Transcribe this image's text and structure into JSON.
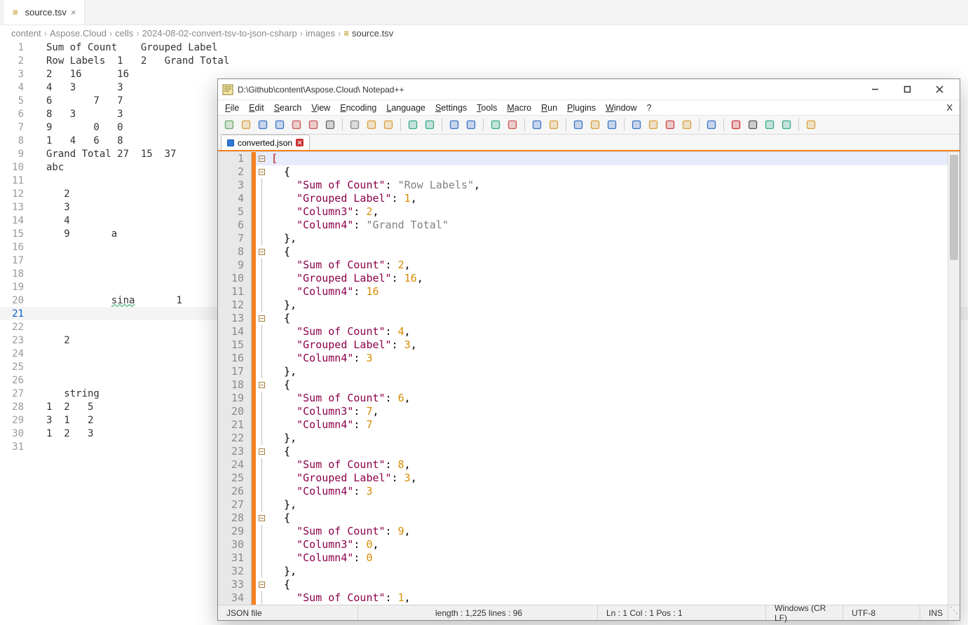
{
  "vs": {
    "tab_label": "source.tsv",
    "breadcrumbs": [
      "content",
      "Aspose.Cloud",
      "cells",
      "2024-08-02-convert-tsv-to-json-csharp",
      "images",
      "source.tsv"
    ],
    "lines": [
      {
        "n": 1,
        "t": "Sum of Count    Grouped Label"
      },
      {
        "n": 2,
        "t": "Row Labels  1   2   Grand Total"
      },
      {
        "n": 3,
        "t": "2   16      16"
      },
      {
        "n": 4,
        "t": "4   3       3"
      },
      {
        "n": 5,
        "t": "6       7   7"
      },
      {
        "n": 6,
        "t": "8   3       3"
      },
      {
        "n": 7,
        "t": "9       0   0"
      },
      {
        "n": 8,
        "t": "1   4   6   8"
      },
      {
        "n": 9,
        "t": "Grand Total 27  15  37"
      },
      {
        "n": 10,
        "t": "abc"
      },
      {
        "n": 11,
        "t": ""
      },
      {
        "n": 12,
        "t": "   2"
      },
      {
        "n": 13,
        "t": "   3"
      },
      {
        "n": 14,
        "t": "   4"
      },
      {
        "n": 15,
        "t": "   9       a"
      },
      {
        "n": 16,
        "t": ""
      },
      {
        "n": 17,
        "t": ""
      },
      {
        "n": 18,
        "t": ""
      },
      {
        "n": 19,
        "t": ""
      },
      {
        "n": 20,
        "t": "           sina       1",
        "wavy": true,
        "wavy_word": "sina"
      },
      {
        "n": 21,
        "t": "",
        "active": true
      },
      {
        "n": 22,
        "t": ""
      },
      {
        "n": 23,
        "t": "   2"
      },
      {
        "n": 24,
        "t": ""
      },
      {
        "n": 25,
        "t": ""
      },
      {
        "n": 26,
        "t": ""
      },
      {
        "n": 27,
        "t": "   string"
      },
      {
        "n": 28,
        "t": "1  2   5"
      },
      {
        "n": 29,
        "t": "3  1   2"
      },
      {
        "n": 30,
        "t": "1  2   3"
      },
      {
        "n": 31,
        "t": ""
      }
    ]
  },
  "npp": {
    "title": "D:\\Github\\content\\Aspose.Cloud\\ Notepad++",
    "menus": [
      "File",
      "Edit",
      "Search",
      "View",
      "Encoding",
      "Language",
      "Settings",
      "Tools",
      "Macro",
      "Run",
      "Plugins",
      "Window",
      "?"
    ],
    "tab_label": "converted.json",
    "status": {
      "type": "JSON file",
      "length": "length : 1,225    lines : 96",
      "pos": "Ln : 1    Col : 1    Pos : 1",
      "eol": "Windows (CR LF)",
      "enc": "UTF-8",
      "mode": "INS"
    },
    "code_lines": [
      {
        "n": 1,
        "fold": "box",
        "hl": true,
        "spans": [
          [
            "brk",
            "["
          ]
        ]
      },
      {
        "n": 2,
        "fold": "box",
        "spans": [
          [
            "punc",
            "  {"
          ]
        ]
      },
      {
        "n": 3,
        "fold": "pipe",
        "spans": [
          [
            "punc",
            "    "
          ],
          [
            "key",
            "\"Sum of Count\""
          ],
          [
            "punc",
            ": "
          ],
          [
            "str",
            "\"Row Labels\""
          ],
          [
            "punc",
            ","
          ]
        ]
      },
      {
        "n": 4,
        "fold": "pipe",
        "spans": [
          [
            "punc",
            "    "
          ],
          [
            "key",
            "\"Grouped Label\""
          ],
          [
            "punc",
            ": "
          ],
          [
            "num",
            "1"
          ],
          [
            "punc",
            ","
          ]
        ]
      },
      {
        "n": 5,
        "fold": "pipe",
        "spans": [
          [
            "punc",
            "    "
          ],
          [
            "key",
            "\"Column3\""
          ],
          [
            "punc",
            ": "
          ],
          [
            "num",
            "2"
          ],
          [
            "punc",
            ","
          ]
        ]
      },
      {
        "n": 6,
        "fold": "pipe",
        "spans": [
          [
            "punc",
            "    "
          ],
          [
            "key",
            "\"Column4\""
          ],
          [
            "punc",
            ": "
          ],
          [
            "str",
            "\"Grand Total\""
          ]
        ]
      },
      {
        "n": 7,
        "fold": "pipe",
        "spans": [
          [
            "punc",
            "  },"
          ]
        ]
      },
      {
        "n": 8,
        "fold": "box",
        "spans": [
          [
            "punc",
            "  {"
          ]
        ]
      },
      {
        "n": 9,
        "fold": "pipe",
        "spans": [
          [
            "punc",
            "    "
          ],
          [
            "key",
            "\"Sum of Count\""
          ],
          [
            "punc",
            ": "
          ],
          [
            "num",
            "2"
          ],
          [
            "punc",
            ","
          ]
        ]
      },
      {
        "n": 10,
        "fold": "pipe",
        "spans": [
          [
            "punc",
            "    "
          ],
          [
            "key",
            "\"Grouped Label\""
          ],
          [
            "punc",
            ": "
          ],
          [
            "num",
            "16"
          ],
          [
            "punc",
            ","
          ]
        ]
      },
      {
        "n": 11,
        "fold": "pipe",
        "spans": [
          [
            "punc",
            "    "
          ],
          [
            "key",
            "\"Column4\""
          ],
          [
            "punc",
            ": "
          ],
          [
            "num",
            "16"
          ]
        ]
      },
      {
        "n": 12,
        "fold": "pipe",
        "spans": [
          [
            "punc",
            "  },"
          ]
        ]
      },
      {
        "n": 13,
        "fold": "box",
        "spans": [
          [
            "punc",
            "  {"
          ]
        ]
      },
      {
        "n": 14,
        "fold": "pipe",
        "spans": [
          [
            "punc",
            "    "
          ],
          [
            "key",
            "\"Sum of Count\""
          ],
          [
            "punc",
            ": "
          ],
          [
            "num",
            "4"
          ],
          [
            "punc",
            ","
          ]
        ]
      },
      {
        "n": 15,
        "fold": "pipe",
        "spans": [
          [
            "punc",
            "    "
          ],
          [
            "key",
            "\"Grouped Label\""
          ],
          [
            "punc",
            ": "
          ],
          [
            "num",
            "3"
          ],
          [
            "punc",
            ","
          ]
        ]
      },
      {
        "n": 16,
        "fold": "pipe",
        "spans": [
          [
            "punc",
            "    "
          ],
          [
            "key",
            "\"Column4\""
          ],
          [
            "punc",
            ": "
          ],
          [
            "num",
            "3"
          ]
        ]
      },
      {
        "n": 17,
        "fold": "pipe",
        "spans": [
          [
            "punc",
            "  },"
          ]
        ]
      },
      {
        "n": 18,
        "fold": "box",
        "spans": [
          [
            "punc",
            "  {"
          ]
        ]
      },
      {
        "n": 19,
        "fold": "pipe",
        "spans": [
          [
            "punc",
            "    "
          ],
          [
            "key",
            "\"Sum of Count\""
          ],
          [
            "punc",
            ": "
          ],
          [
            "num",
            "6"
          ],
          [
            "punc",
            ","
          ]
        ]
      },
      {
        "n": 20,
        "fold": "pipe",
        "spans": [
          [
            "punc",
            "    "
          ],
          [
            "key",
            "\"Column3\""
          ],
          [
            "punc",
            ": "
          ],
          [
            "num",
            "7"
          ],
          [
            "punc",
            ","
          ]
        ]
      },
      {
        "n": 21,
        "fold": "pipe",
        "spans": [
          [
            "punc",
            "    "
          ],
          [
            "key",
            "\"Column4\""
          ],
          [
            "punc",
            ": "
          ],
          [
            "num",
            "7"
          ]
        ]
      },
      {
        "n": 22,
        "fold": "pipe",
        "spans": [
          [
            "punc",
            "  },"
          ]
        ]
      },
      {
        "n": 23,
        "fold": "box",
        "spans": [
          [
            "punc",
            "  {"
          ]
        ]
      },
      {
        "n": 24,
        "fold": "pipe",
        "spans": [
          [
            "punc",
            "    "
          ],
          [
            "key",
            "\"Sum of Count\""
          ],
          [
            "punc",
            ": "
          ],
          [
            "num",
            "8"
          ],
          [
            "punc",
            ","
          ]
        ]
      },
      {
        "n": 25,
        "fold": "pipe",
        "spans": [
          [
            "punc",
            "    "
          ],
          [
            "key",
            "\"Grouped Label\""
          ],
          [
            "punc",
            ": "
          ],
          [
            "num",
            "3"
          ],
          [
            "punc",
            ","
          ]
        ]
      },
      {
        "n": 26,
        "fold": "pipe",
        "spans": [
          [
            "punc",
            "    "
          ],
          [
            "key",
            "\"Column4\""
          ],
          [
            "punc",
            ": "
          ],
          [
            "num",
            "3"
          ]
        ]
      },
      {
        "n": 27,
        "fold": "pipe",
        "spans": [
          [
            "punc",
            "  },"
          ]
        ]
      },
      {
        "n": 28,
        "fold": "box",
        "spans": [
          [
            "punc",
            "  {"
          ]
        ]
      },
      {
        "n": 29,
        "fold": "pipe",
        "spans": [
          [
            "punc",
            "    "
          ],
          [
            "key",
            "\"Sum of Count\""
          ],
          [
            "punc",
            ": "
          ],
          [
            "num",
            "9"
          ],
          [
            "punc",
            ","
          ]
        ]
      },
      {
        "n": 30,
        "fold": "pipe",
        "spans": [
          [
            "punc",
            "    "
          ],
          [
            "key",
            "\"Column3\""
          ],
          [
            "punc",
            ": "
          ],
          [
            "num",
            "0"
          ],
          [
            "punc",
            ","
          ]
        ]
      },
      {
        "n": 31,
        "fold": "pipe",
        "spans": [
          [
            "punc",
            "    "
          ],
          [
            "key",
            "\"Column4\""
          ],
          [
            "punc",
            ": "
          ],
          [
            "num",
            "0"
          ]
        ]
      },
      {
        "n": 32,
        "fold": "pipe",
        "spans": [
          [
            "punc",
            "  },"
          ]
        ]
      },
      {
        "n": 33,
        "fold": "box",
        "spans": [
          [
            "punc",
            "  {"
          ]
        ]
      },
      {
        "n": 34,
        "fold": "pipe",
        "spans": [
          [
            "punc",
            "    "
          ],
          [
            "key",
            "\"Sum of Count\""
          ],
          [
            "punc",
            ": "
          ],
          [
            "num",
            "1"
          ],
          [
            "punc",
            ","
          ]
        ]
      }
    ]
  },
  "icons": {
    "toolbar": [
      "new",
      "open",
      "save",
      "save-all",
      "close",
      "close-all",
      "print",
      "",
      "cut",
      "copy",
      "paste",
      "",
      "undo",
      "redo",
      "",
      "find",
      "replace",
      "",
      "zoom-in",
      "zoom-out",
      "",
      "sync",
      "toggle",
      "",
      "wrap",
      "show-all",
      "indent",
      "",
      "fold",
      "unfold",
      "hide",
      "folder",
      "",
      "eye",
      "",
      "record",
      "stop",
      "play",
      "play-fast",
      "",
      "settings"
    ]
  }
}
